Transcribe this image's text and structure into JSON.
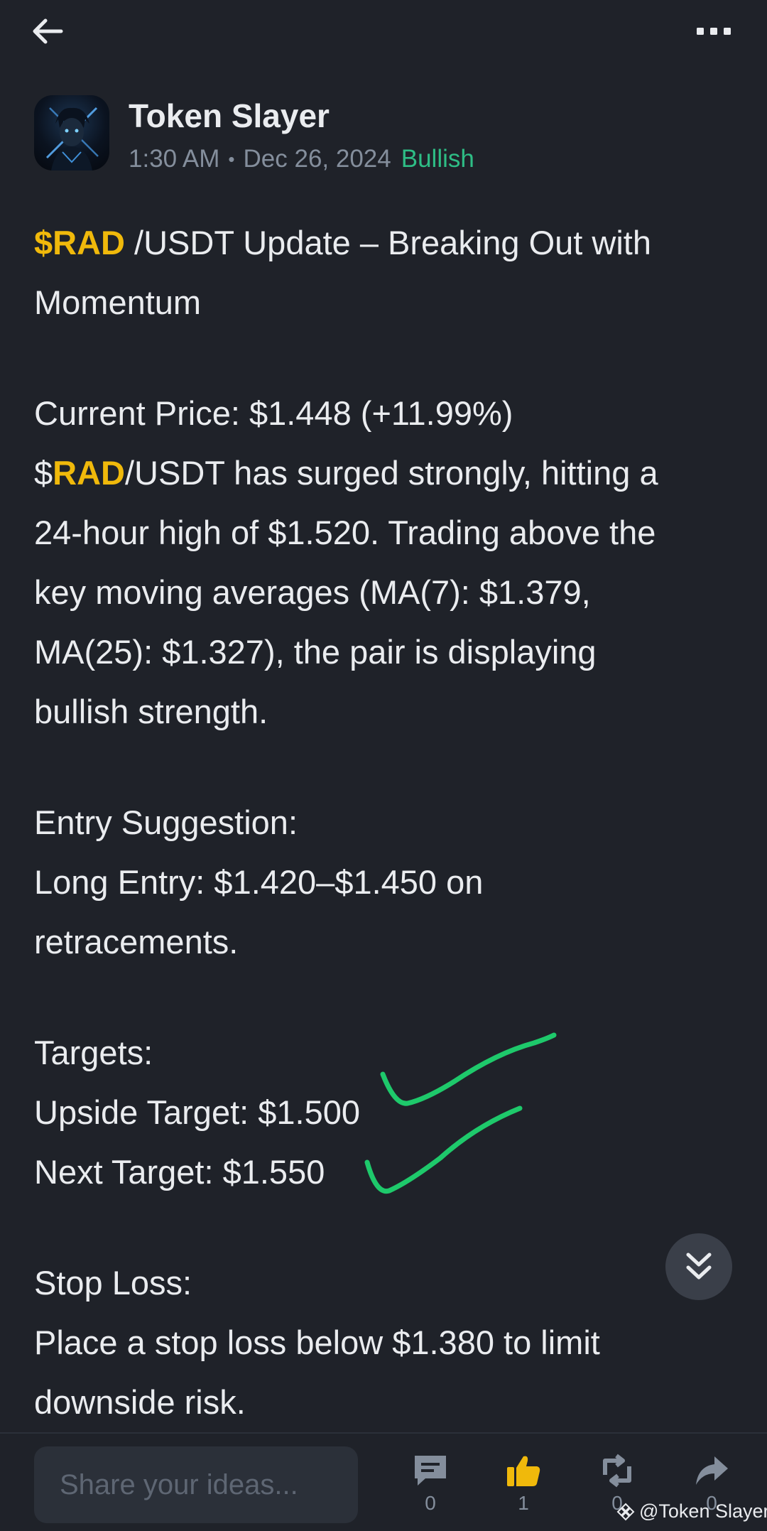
{
  "topbar": {
    "back_icon": "arrow-left-icon",
    "more_icon": "more-dots-icon"
  },
  "post": {
    "author": "Token Slayer",
    "time": "1:30 AM",
    "separator": "•",
    "date": "Dec 26, 2024",
    "sentiment": "Bullish",
    "lines": {
      "title_tag": "$RAD",
      "title_rest": " /USDT Update – Breaking Out with",
      "title_line2": "Momentum",
      "price_line": "Current Price: $1.448 (+11.99%)",
      "surge_dollar": "$",
      "surge_tag": "RAD",
      "surge_rest": "/USDT has surged strongly, hitting a",
      "surge_line2": "24-hour high of $1.520. Trading above the",
      "surge_line3": "key moving averages (MA(7): $1.379,",
      "surge_line4": "MA(25): $1.327), the pair is displaying",
      "surge_line5": "bullish strength.",
      "entry_heading": "Entry Suggestion:",
      "entry_line1": "Long Entry: $1.420–$1.450 on",
      "entry_line2": "retracements.",
      "targets_heading": "Targets:",
      "target1": "Upside Target: $1.500",
      "target2": "Next Target: $1.550",
      "stop_heading": "Stop Loss:",
      "stop_line1": "Place a stop loss below $1.380 to limit",
      "stop_line2": "downside risk."
    }
  },
  "colors": {
    "background": "#1f2229",
    "accent": "#f0b90b",
    "bullish": "#2ebd85",
    "check_marks": "#1ec96b"
  },
  "bottombar": {
    "input_placeholder": "Share your ideas...",
    "comments": {
      "icon": "comment-icon",
      "count": "0"
    },
    "likes": {
      "icon": "thumbs-up-icon",
      "count": "1"
    },
    "reposts": {
      "icon": "repost-icon",
      "count": "0"
    },
    "shares": {
      "icon": "share-icon",
      "count": "0"
    }
  },
  "scroll_button_icon": "double-chevron-down-icon",
  "watermark": "@Token Slayer"
}
